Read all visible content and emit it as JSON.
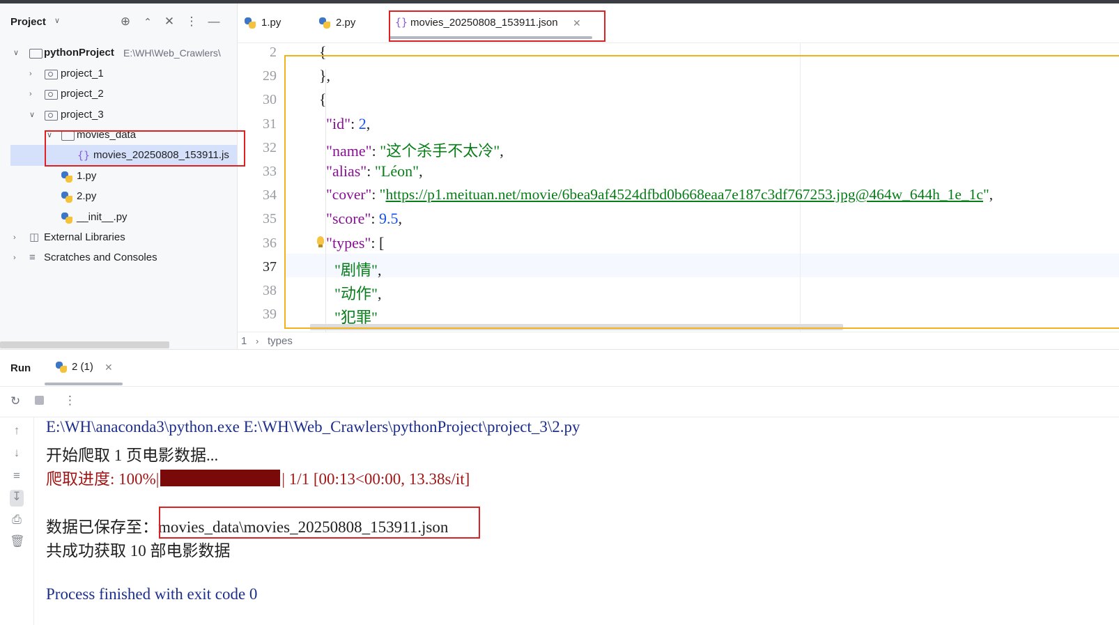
{
  "project_panel": {
    "title": "Project",
    "root": {
      "name": "pythonProject",
      "path": "E:\\WH\\Web_Crawlers\\"
    },
    "items": [
      {
        "label": "project_1"
      },
      {
        "label": "project_2"
      },
      {
        "label": "project_3"
      },
      {
        "label": "movies_data"
      },
      {
        "label": "movies_20250808_153911.js"
      },
      {
        "label": "1.py"
      },
      {
        "label": "2.py"
      },
      {
        "label": "__init__.py"
      },
      {
        "label": "External Libraries"
      },
      {
        "label": "Scratches and Consoles"
      }
    ]
  },
  "editor": {
    "tabs": [
      {
        "label": "1.py"
      },
      {
        "label": "2.py"
      },
      {
        "label": "movies_20250808_153911.json"
      }
    ],
    "line_numbers": [
      "2",
      "29",
      "30",
      "31",
      "32",
      "33",
      "34",
      "35",
      "36",
      "37",
      "38",
      "39"
    ],
    "code": {
      "l2": "{",
      "l29": "},",
      "l30": "{",
      "id_key": "\"id\"",
      "id_val": "2",
      "name_key": "\"name\"",
      "name_val": "\"这个杀手不太冷\"",
      "alias_key": "\"alias\"",
      "alias_val": "\"Léon\"",
      "cover_key": "\"cover\"",
      "cover_val": "https://p1.meituan.net/movie/6bea9af4524dfbd0b668eaa7e187c3df767253.jpg@464w_644h_1e_1c",
      "score_key": "\"score\"",
      "score_val": "9.5",
      "types_key": "\"types\"",
      "type1": "\"剧情\"",
      "type2": "\"动作\"",
      "type3": "\"犯罪\""
    },
    "breadcrumb": {
      "index": "1",
      "path": "types"
    }
  },
  "run_panel": {
    "title": "Run",
    "tab": "2 (1)",
    "console": {
      "cmd": "E:\\WH\\anaconda3\\python.exe E:\\WH\\Web_Crawlers\\pythonProject\\project_3\\2.py",
      "start": "开始爬取 1 页电影数据...",
      "progress_prefix": "爬取进度: 100%|",
      "progress_suffix": "| 1/1 [00:13<00:00, 13.38s/it]",
      "progress_fraction": 1.0,
      "saved_prefix": "数据已保存至：",
      "saved_path": "movies_data\\movies_20250808_153911.json",
      "count": "共成功获取 10 部电影数据",
      "finished": "Process finished with exit code 0"
    }
  },
  "colors": {
    "highlight_red": "#e02020",
    "highlight_yellow": "#f2b21b",
    "progress_bar": "#7a0a0a"
  }
}
